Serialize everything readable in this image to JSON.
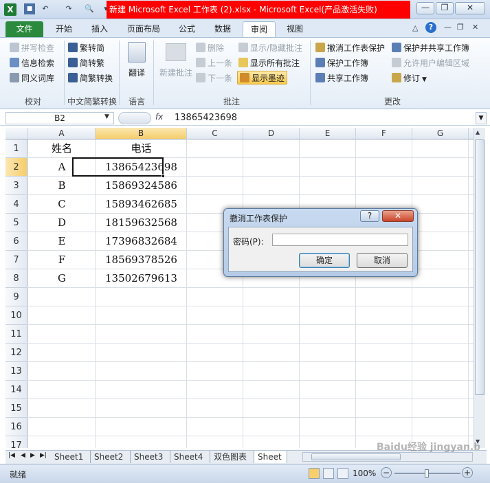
{
  "titlebar": {
    "title": "新建 Microsoft Excel 工作表 (2).xlsx - Microsoft Excel(产品激活失败)",
    "app_icon": "X"
  },
  "tabs": [
    "文件",
    "开始",
    "插入",
    "页面布局",
    "公式",
    "数据",
    "审阅",
    "视图"
  ],
  "ribbon": {
    "proofing": {
      "items": [
        "拼写检查",
        "信息检索",
        "同义词库"
      ],
      "label": "校对"
    },
    "chinese": {
      "items": [
        "繁转简",
        "简转繁",
        "简繁转换"
      ],
      "label": "中文简繁转换"
    },
    "language": {
      "item": "翻译",
      "label": "语言"
    },
    "comments": {
      "new": "新建批注",
      "items": [
        "删除",
        "上一条",
        "下一条"
      ],
      "items2": [
        "显示/隐藏批注",
        "显示所有批注",
        "显示墨迹"
      ],
      "label": "批注"
    },
    "changes": {
      "items": [
        "撤消工作表保护",
        "保护工作簿",
        "共享工作簿"
      ],
      "items2": [
        "保护并共享工作簿",
        "允许用户编辑区域",
        "修订"
      ],
      "label": "更改"
    }
  },
  "formula": {
    "namebox": "B2",
    "fx": "fx",
    "value": "13865423698"
  },
  "columns": [
    "A",
    "B",
    "C",
    "D",
    "E",
    "F",
    "G",
    "H"
  ],
  "rows": [
    "1",
    "2",
    "3",
    "4",
    "5",
    "6",
    "7",
    "8",
    "9",
    "10",
    "11",
    "12",
    "13",
    "14",
    "15",
    "16",
    "17"
  ],
  "headers": [
    "姓名",
    "电话"
  ],
  "table": [
    [
      "A",
      "13865423698"
    ],
    [
      "B",
      "15869324586"
    ],
    [
      "C",
      "15893462685"
    ],
    [
      "D",
      "18159632568"
    ],
    [
      "E",
      "17396832684"
    ],
    [
      "F",
      "18569378526"
    ],
    [
      "G",
      "13502679613"
    ]
  ],
  "sheets": [
    "Sheet1",
    "Sheet2",
    "Sheet3",
    "Sheet4",
    "双色图表",
    "Sheet"
  ],
  "status": {
    "ready": "就绪",
    "zoom": "100%"
  },
  "dialog": {
    "title": "撤消工作表保护",
    "help": "?",
    "close": "✕",
    "password_label": "密码(P):",
    "password_value": "",
    "ok": "确定",
    "cancel": "取消"
  },
  "watermark": "Baidu经验 jingyan.baidu.com"
}
